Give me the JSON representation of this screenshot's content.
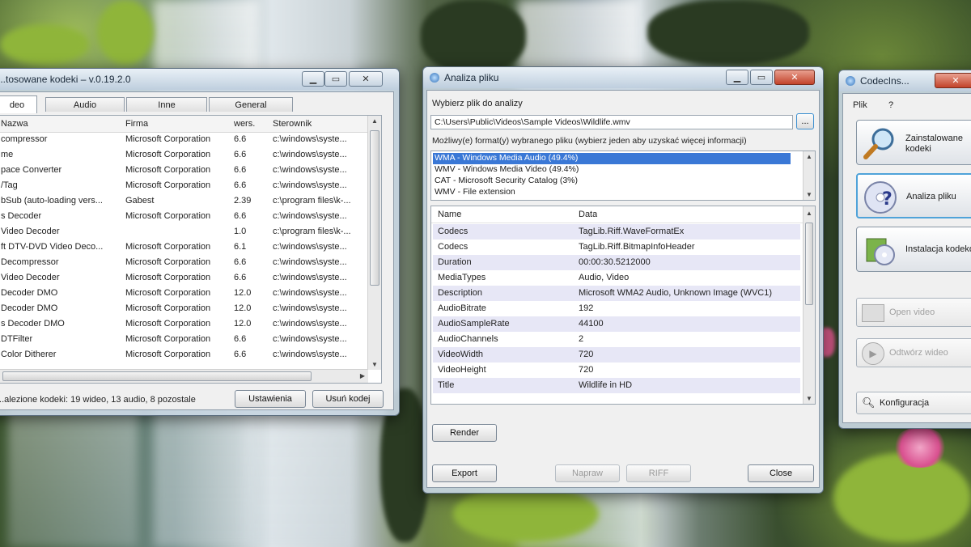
{
  "codecs_window": {
    "title": "...tosowane kodeki – v.0.19.2.0",
    "tabs": [
      "deo",
      "Audio",
      "Inne",
      "General"
    ],
    "columns": [
      "Nazwa",
      "Firma",
      "wers.",
      "Sterownik"
    ],
    "rows": [
      [
        "compressor",
        "Microsoft Corporation",
        "6.6",
        "c:\\windows\\syste..."
      ],
      [
        "me",
        "Microsoft Corporation",
        "6.6",
        "c:\\windows\\syste..."
      ],
      [
        "pace Converter",
        "Microsoft Corporation",
        "6.6",
        "c:\\windows\\syste..."
      ],
      [
        "/Tag",
        "Microsoft Corporation",
        "6.6",
        "c:\\windows\\syste..."
      ],
      [
        "bSub (auto-loading vers...",
        "Gabest",
        "2.39",
        "c:\\program files\\k-..."
      ],
      [
        "s Decoder",
        "Microsoft Corporation",
        "6.6",
        "c:\\windows\\syste..."
      ],
      [
        "Video Decoder",
        "",
        "1.0",
        "c:\\program files\\k-..."
      ],
      [
        "ft DTV-DVD Video Deco...",
        "Microsoft Corporation",
        "6.1",
        "c:\\windows\\syste..."
      ],
      [
        "Decompressor",
        "Microsoft Corporation",
        "6.6",
        "c:\\windows\\syste..."
      ],
      [
        "Video Decoder",
        "Microsoft Corporation",
        "6.6",
        "c:\\windows\\syste..."
      ],
      [
        "Decoder DMO",
        "Microsoft Corporation",
        "12.0",
        "c:\\windows\\syste..."
      ],
      [
        "Decoder DMO",
        "Microsoft Corporation",
        "12.0",
        "c:\\windows\\syste..."
      ],
      [
        "s Decoder DMO",
        "Microsoft Corporation",
        "12.0",
        "c:\\windows\\syste..."
      ],
      [
        "DTFilter",
        "Microsoft Corporation",
        "6.6",
        "c:\\windows\\syste..."
      ],
      [
        "Color Ditherer",
        "Microsoft Corporation",
        "6.6",
        "c:\\windows\\syste..."
      ]
    ],
    "status": "...alezione kodeki: 19 wideo, 13 audio, 8 pozostale",
    "settings_button": "Ustawienia",
    "uninstall_button": "Usuń kodej"
  },
  "analysis_window": {
    "title": "Analiza pliku",
    "file_label": "Wybierz plik do analizy",
    "file_path": "C:\\Users\\Public\\Videos\\Sample Videos\\Wildlife.wmv",
    "browse_label": "...",
    "formats_label": "Możliwy(e) format(y) wybranego pliku (wybierz jeden aby uzyskać więcej informacji)",
    "formats": [
      "WMA - Windows Media Audio (49.4%)",
      "WMV - Windows Media Video (49.4%)",
      "CAT - Microsoft Security Catalog (3%)",
      "WMV - File extension"
    ],
    "columns": [
      "Name",
      "Data"
    ],
    "properties": [
      [
        "Codecs",
        "TagLib.Riff.WaveFormatEx"
      ],
      [
        "Codecs",
        "TagLib.Riff.BitmapInfoHeader"
      ],
      [
        "Duration",
        "00:00:30.5212000"
      ],
      [
        "MediaTypes",
        "Audio, Video"
      ],
      [
        "Description",
        "Microsoft WMA2 Audio, Unknown Image (WVC1)"
      ],
      [
        "AudioBitrate",
        "192"
      ],
      [
        "AudioSampleRate",
        "44100"
      ],
      [
        "AudioChannels",
        "2"
      ],
      [
        "VideoWidth",
        "720"
      ],
      [
        "VideoHeight",
        "720"
      ],
      [
        "Title",
        "Wildlife in HD"
      ]
    ],
    "render_button": "Render",
    "export_button": "Export",
    "repair_button": "Napraw",
    "riff_button": "RIFF",
    "close_button": "Close"
  },
  "tweak_window": {
    "title": "CodecIns...",
    "menu": [
      "Plik",
      "?"
    ],
    "buttons": [
      {
        "label": "Zainstalowane\nkodeki",
        "icon": "magnifier-icon"
      },
      {
        "label": "Analiza pliku",
        "icon": "disc-help-icon"
      },
      {
        "label": "Instalacja kodeków",
        "icon": "install-icon"
      }
    ],
    "open_video": "Open video",
    "play_video": "Odtwórz wideo",
    "config": "Konfiguracja"
  }
}
